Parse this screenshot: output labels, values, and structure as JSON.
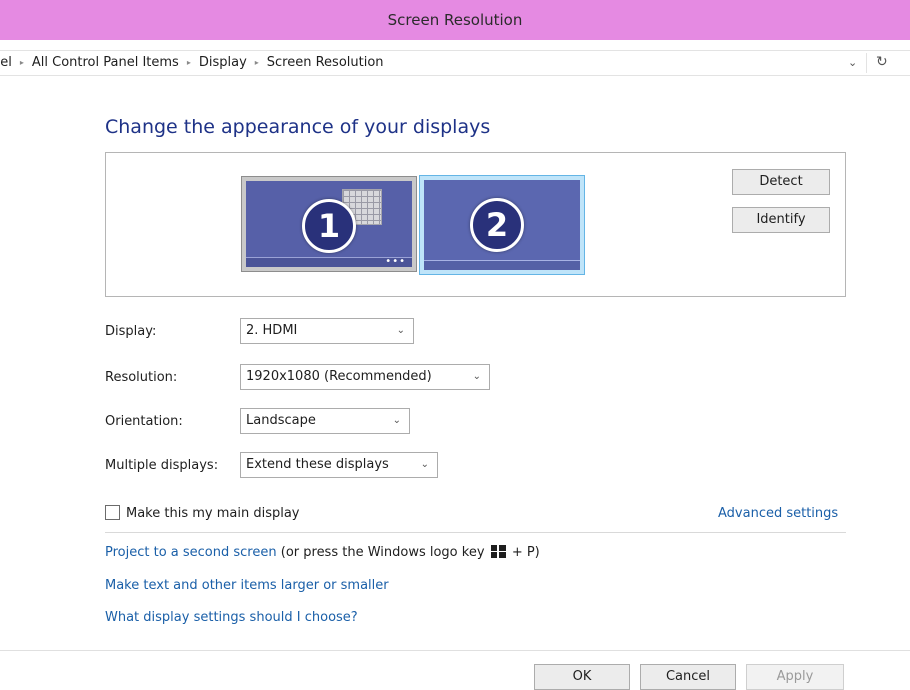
{
  "window": {
    "title": "Screen Resolution"
  },
  "breadcrumb": {
    "items": [
      "nel",
      "All Control Panel Items",
      "Display",
      "Screen Resolution"
    ],
    "separator": "▸",
    "dropdown_icon": "chevron-down-icon",
    "refresh_icon": "refresh-icon"
  },
  "main": {
    "heading": "Change the appearance of your displays",
    "monitors": [
      {
        "number": "1",
        "state": "inactive"
      },
      {
        "number": "2",
        "state": "selected"
      }
    ],
    "detect_label": "Detect",
    "identify_label": "Identify"
  },
  "form": {
    "display": {
      "label": "Display:",
      "value": "2. HDMI"
    },
    "resolution": {
      "label": "Resolution:",
      "value": "1920x1080 (Recommended)"
    },
    "orientation": {
      "label": "Orientation:",
      "value": "Landscape"
    },
    "multiple": {
      "label": "Multiple displays:",
      "value": "Extend these displays"
    },
    "main_display": {
      "label": "Make this my main display",
      "checked": false
    },
    "advanced_link": "Advanced settings"
  },
  "links": {
    "project": "Project to a second screen",
    "project_hint_pre": "(or press the Windows logo key",
    "project_hint_post": "+ P)",
    "text_size": "Make text and other items larger or smaller",
    "which_settings": "What display settings should I choose?"
  },
  "footer": {
    "ok_label": "OK",
    "cancel_label": "Cancel",
    "apply_label": "Apply"
  },
  "colors": {
    "titlebar": "#e58ae2",
    "heading": "#1e3287",
    "link": "#1a5fa8",
    "monitor_screen": "#5660a8",
    "selection": "#64b5e5"
  }
}
